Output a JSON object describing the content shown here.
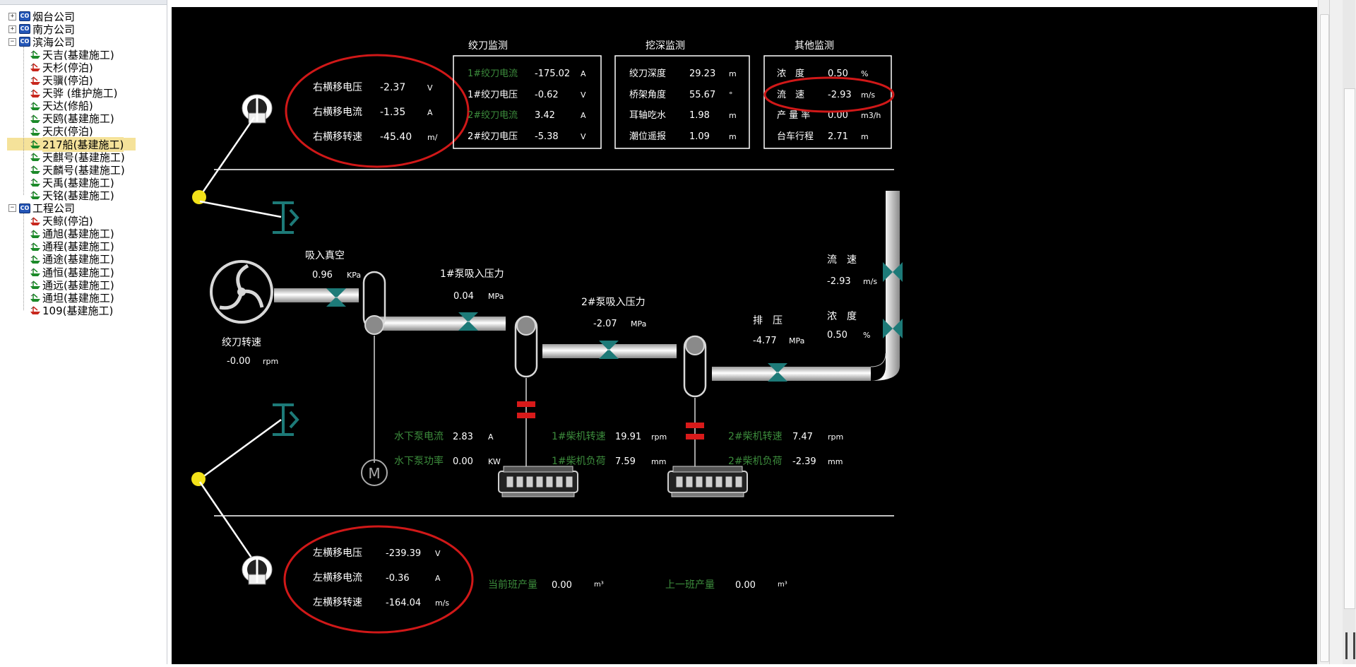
{
  "tree": {
    "companies": [
      {
        "label": "烟台公司",
        "expander": "+",
        "ships": []
      },
      {
        "label": "南方公司",
        "expander": "+",
        "ships": []
      },
      {
        "label": "滨海公司",
        "expander": "−",
        "ships": [
          {
            "label": "天吉(基建施工)",
            "color": "green"
          },
          {
            "label": "天杉(停泊)",
            "color": "red"
          },
          {
            "label": "天骥(停泊)",
            "color": "red"
          },
          {
            "label": "天骅 (维护施工)",
            "color": "red"
          },
          {
            "label": "天达(修船)",
            "color": "green"
          },
          {
            "label": "天鸥(基建施工)",
            "color": "green"
          },
          {
            "label": "天庆(停泊)",
            "color": "green"
          },
          {
            "label": "217船(基建施工)",
            "color": "green",
            "selected": true
          },
          {
            "label": "天麒号(基建施工)",
            "color": "green"
          },
          {
            "label": "天麟号(基建施工)",
            "color": "green"
          },
          {
            "label": "天禹(基建施工)",
            "color": "green"
          },
          {
            "label": "天铭(基建施工)",
            "color": "green"
          }
        ]
      },
      {
        "label": "工程公司",
        "expander": "−",
        "ships": [
          {
            "label": "天鲸(停泊)",
            "color": "red"
          },
          {
            "label": "通旭(基建施工)",
            "color": "green"
          },
          {
            "label": "通程(基建施工)",
            "color": "green"
          },
          {
            "label": "通途(基建施工)",
            "color": "green"
          },
          {
            "label": "通恒(基建施工)",
            "color": "green"
          },
          {
            "label": "通远(基建施工)",
            "color": "green"
          },
          {
            "label": "通坦(基建施工)",
            "color": "green"
          },
          {
            "label": "109(基建施工)",
            "color": "red"
          }
        ]
      }
    ]
  },
  "colors": {
    "background": "#000000",
    "text": "#ffffff",
    "green_label": "#3c8c3c",
    "valve": "#1d7a78",
    "alert_ring": "#d01818",
    "pipe": "#d8d8d8"
  },
  "right_traverse": {
    "rows": [
      {
        "label": "右横移电压",
        "value": "-2.37",
        "unit": "V"
      },
      {
        "label": "右横移电流",
        "value": "-1.35",
        "unit": "A"
      },
      {
        "label": "右横移转速",
        "value": "-45.40",
        "unit": "m/"
      }
    ]
  },
  "cutter_monitor": {
    "title": "绞刀监测",
    "rows": [
      {
        "label": "1#绞刀电流",
        "value": "-175.02",
        "unit": "A",
        "green": true
      },
      {
        "label": "1#绞刀电压",
        "value": "-0.62",
        "unit": "V",
        "green": false
      },
      {
        "label": "2#绞刀电流",
        "value": "3.42",
        "unit": "A",
        "green": true
      },
      {
        "label": "2#绞刀电压",
        "value": "-5.38",
        "unit": "V",
        "green": false
      }
    ]
  },
  "dig_monitor": {
    "title": "挖深监测",
    "rows": [
      {
        "label": "绞刀深度",
        "value": "29.23",
        "unit": "m"
      },
      {
        "label": "桥架角度",
        "value": "55.67",
        "unit": "°"
      },
      {
        "label": "耳轴吃水",
        "value": "1.98",
        "unit": "m"
      },
      {
        "label": "潮位遥报",
        "value": "1.09",
        "unit": "m"
      }
    ]
  },
  "other_monitor": {
    "title": "其他监测",
    "rows": [
      {
        "label": "浓　度",
        "value": "0.50",
        "unit": "%"
      },
      {
        "label": "流　速",
        "value": "-2.93",
        "unit": "m/s"
      },
      {
        "label": "产 量 率",
        "value": "0.00",
        "unit": "m3/h"
      },
      {
        "label": "台车行程",
        "value": "2.71",
        "unit": "m"
      }
    ]
  },
  "process": {
    "suction_vacuum": {
      "label": "吸入真空",
      "value": "0.96",
      "unit": "KPa"
    },
    "pump1_inlet": {
      "label": "1#泵吸入压力",
      "value": "0.04",
      "unit": "MPa"
    },
    "pump2_inlet": {
      "label": "2#泵吸入压力",
      "value": "-2.07",
      "unit": "MPa"
    },
    "discharge": {
      "label": "排　压",
      "value": "-4.77",
      "unit": "MPa"
    },
    "flow_speed": {
      "label": "流　速",
      "value": "-2.93",
      "unit": "m/s"
    },
    "concentration": {
      "label": "浓　度",
      "value": "0.50",
      "unit": "%"
    },
    "cutter_speed": {
      "label": "绞刀转速",
      "value": "-0.00",
      "unit": "rpm"
    },
    "motor_symbol": "M",
    "underwater_pump": [
      {
        "label": "水下泵电流",
        "value": "2.83",
        "unit": "A"
      },
      {
        "label": "水下泵功率",
        "value": "0.00",
        "unit": "KW"
      }
    ],
    "engine1": [
      {
        "label": "1#柴机转速",
        "value": "19.91",
        "unit": "rpm"
      },
      {
        "label": "1#柴机负荷",
        "value": "7.59",
        "unit": "mm"
      }
    ],
    "engine2": [
      {
        "label": "2#柴机转速",
        "value": "7.47",
        "unit": "rpm"
      },
      {
        "label": "2#柴机负荷",
        "value": "-2.39",
        "unit": "mm"
      }
    ]
  },
  "left_traverse": {
    "rows": [
      {
        "label": "左横移电压",
        "value": "-239.39",
        "unit": "V"
      },
      {
        "label": "左横移电流",
        "value": "-0.36",
        "unit": "A"
      },
      {
        "label": "左横移转速",
        "value": "-164.04",
        "unit": "m/s"
      }
    ]
  },
  "production": {
    "current": {
      "label": "当前班产量",
      "value": "0.00",
      "unit": "m³"
    },
    "previous": {
      "label": "上一班产量",
      "value": "0.00",
      "unit": "m³"
    }
  }
}
